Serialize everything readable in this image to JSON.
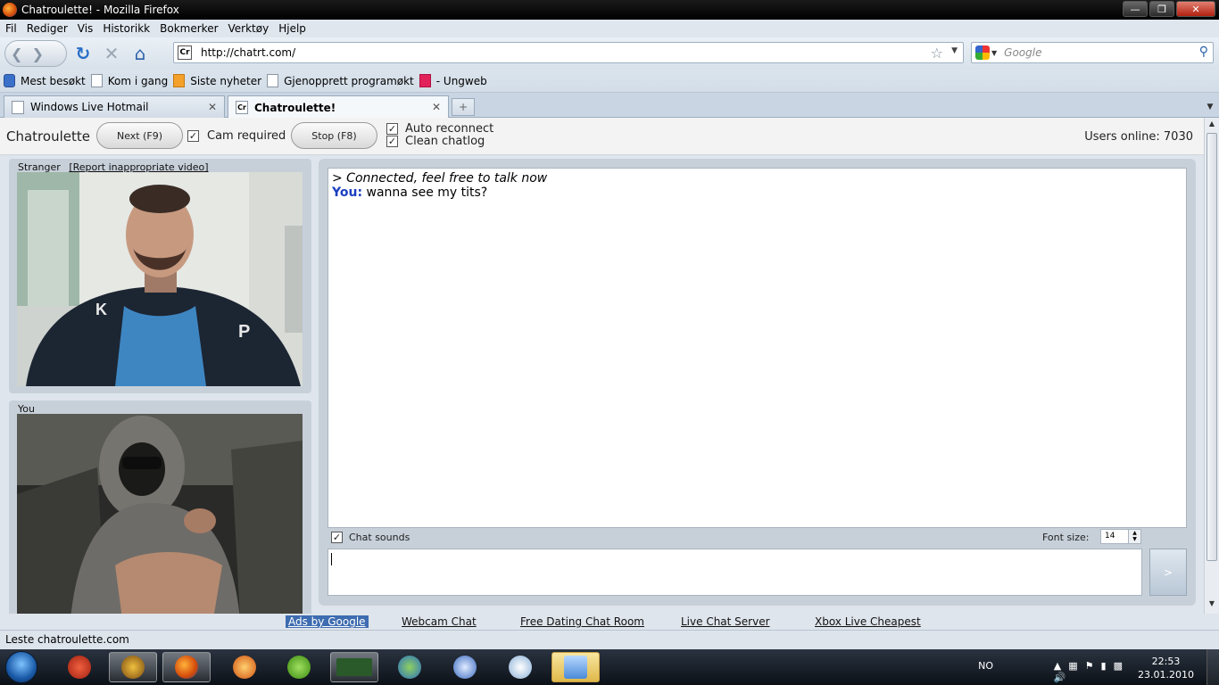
{
  "window": {
    "title": "Chatroulette! - Mozilla Firefox"
  },
  "menu": [
    "Fil",
    "Rediger",
    "Vis",
    "Historikk",
    "Bokmerker",
    "Verktøy",
    "Hjelp"
  ],
  "nav": {
    "url": "http://chatrt.com/",
    "url_favicon": "Cr",
    "search_placeholder": "Google"
  },
  "bookmarks": [
    "Mest besøkt",
    "Kom i gang",
    "Siste nyheter",
    "Gjenopprett programøkt",
    "- Ungweb"
  ],
  "tabs": [
    {
      "label": "Windows Live Hotmail",
      "favicon": ""
    },
    {
      "label": "Chatroulette!",
      "favicon": "Cr"
    }
  ],
  "page": {
    "brand": "Chatroulette",
    "next_label": "Next (F9)",
    "cam_required": "Cam required",
    "stop_label": "Stop (F8)",
    "auto_reconnect": "Auto reconnect",
    "clean_chatlog": "Clean chatlog",
    "users_online": "Users online: 7030",
    "stranger_label": "Stranger",
    "report_link": "[Report inappropriate video]",
    "you_label": "You",
    "chat": {
      "system_msg": "> Connected, feel free to talk now",
      "you_name": "You:",
      "you_msg": "wanna see my tits?"
    },
    "chat_sounds": "Chat sounds",
    "font_size_label": "Font size:",
    "font_size_value": "14",
    "send_label": ">"
  },
  "ads": {
    "ads_by": "Ads by Google",
    "links": [
      "Webcam Chat",
      "Free Dating Chat Room",
      "Live Chat Server",
      "Xbox Live Cheapest"
    ]
  },
  "status": "Leste chatroulette.com",
  "taskbar": {
    "lang": "NO",
    "time": "22:53",
    "date": "23.01.2010"
  }
}
